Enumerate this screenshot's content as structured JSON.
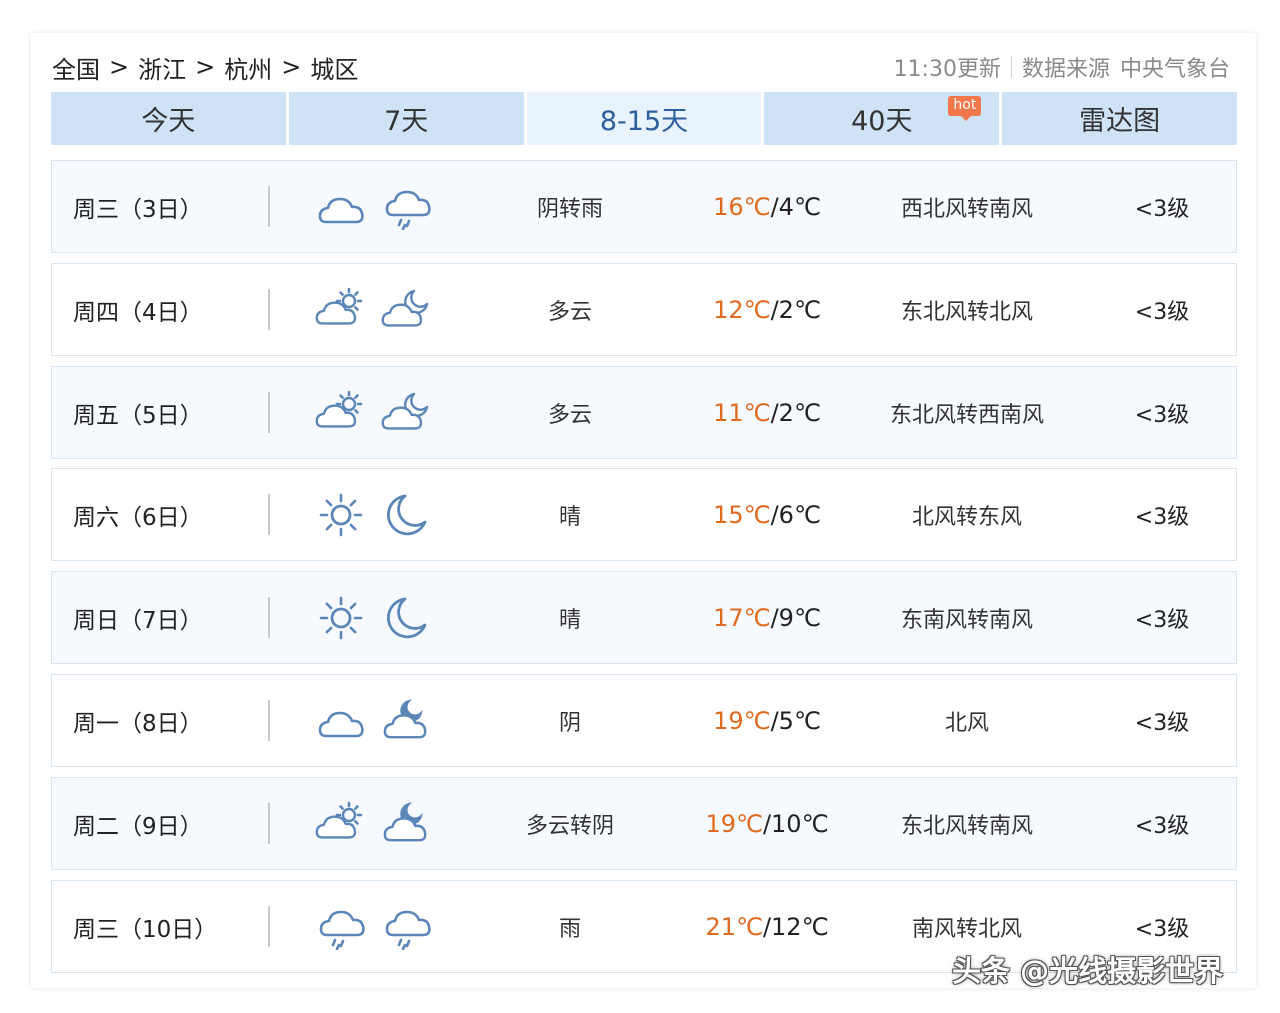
{
  "breadcrumb": [
    "全国",
    "浙江",
    "杭州",
    "城区"
  ],
  "breadcrumb_separator": ">",
  "update_time": "11:30更新",
  "source_label": "数据来源",
  "source_name": "中央气象台",
  "tabs": [
    {
      "label": "今天"
    },
    {
      "label": "7天"
    },
    {
      "label": "8-15天",
      "active": true
    },
    {
      "label": "40天",
      "badge": "hot"
    },
    {
      "label": "雷达图"
    }
  ],
  "forecast": [
    {
      "day": "周三（3日）",
      "icon_day": "cloudy-icon",
      "icon_night": "rain-icon",
      "weather": "阴转雨",
      "high": "16℃",
      "low": "/4℃",
      "wind": "西北风转南风",
      "level": "<3级"
    },
    {
      "day": "周四（4日）",
      "icon_day": "partly-cloudy-day-icon",
      "icon_night": "partly-cloudy-night-icon",
      "weather": "多云",
      "high": "12℃",
      "low": "/2℃",
      "wind": "东北风转北风",
      "level": "<3级"
    },
    {
      "day": "周五（5日）",
      "icon_day": "partly-cloudy-day-icon",
      "icon_night": "partly-cloudy-night-icon",
      "weather": "多云",
      "high": "11℃",
      "low": "/2℃",
      "wind": "东北风转西南风",
      "level": "<3级"
    },
    {
      "day": "周六（6日）",
      "icon_day": "sun-icon",
      "icon_night": "moon-icon",
      "weather": "晴",
      "high": "15℃",
      "low": "/6℃",
      "wind": "北风转东风",
      "level": "<3级"
    },
    {
      "day": "周日（7日）",
      "icon_day": "sun-icon",
      "icon_night": "moon-icon",
      "weather": "晴",
      "high": "17℃",
      "low": "/9℃",
      "wind": "东南风转南风",
      "level": "<3级"
    },
    {
      "day": "周一（8日）",
      "icon_day": "cloudy-icon",
      "icon_night": "cloudy-night-icon",
      "weather": "阴",
      "high": "19℃",
      "low": "/5℃",
      "wind": "北风",
      "level": "<3级"
    },
    {
      "day": "周二（9日）",
      "icon_day": "partly-cloudy-day-icon",
      "icon_night": "cloudy-night-icon",
      "weather": "多云转阴",
      "high": "19℃",
      "low": "/10℃",
      "wind": "东北风转南风",
      "level": "<3级"
    },
    {
      "day": "周三（10日）",
      "icon_day": "rain-icon",
      "icon_night": "rain-icon",
      "weather": "雨",
      "high": "21℃",
      "low": "/12℃",
      "wind": "南风转北风",
      "level": "<3级"
    }
  ],
  "watermark": "头条 @光线摄影世界",
  "colors": {
    "tab_bg": "#cfe3f7",
    "tab_active_bg": "#e8f3fd",
    "tab_active_text": "#2d5e9e",
    "high_temp": "#e06a1e",
    "icon_stroke": "#5a86b8",
    "hot_badge": "#f2784b"
  }
}
